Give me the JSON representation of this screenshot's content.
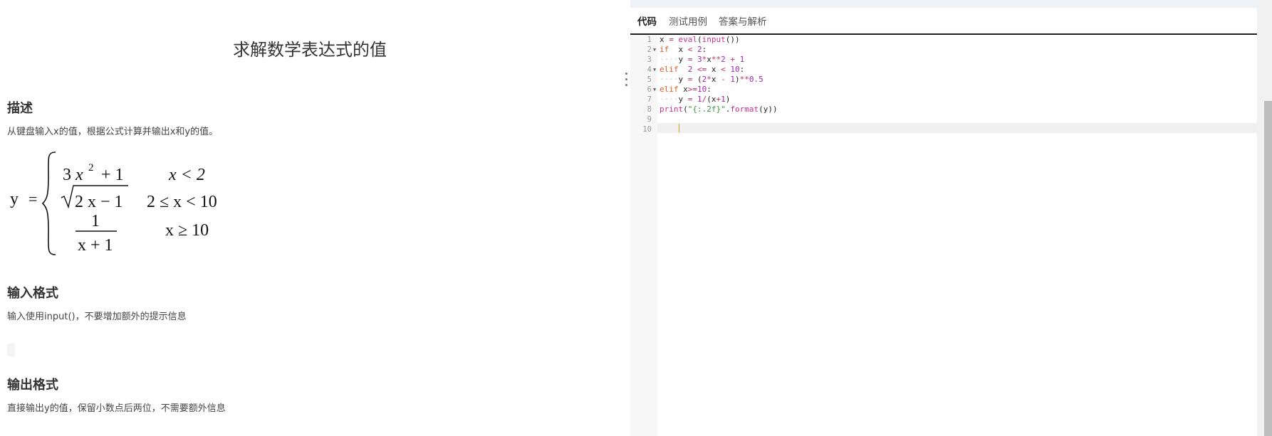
{
  "problem": {
    "title": "求解数学表达式的值",
    "sections": {
      "description_heading": "描述",
      "description_text": "从键盘输入x的值，根据公式计算并输出x和y的值。",
      "input_heading": "输入格式",
      "input_text": "输入使用input()，不要增加额外的提示信息",
      "output_heading": "输出格式",
      "output_text": "直接输出y的值，保留小数点后两位，不需要额外信息"
    },
    "formula": {
      "lhs": "y",
      "eq": "=",
      "case1_expr_a": "3",
      "case1_expr_b": "x",
      "case1_exp": "2",
      "case1_expr_c": "+ 1",
      "case1_cond": "x < 2",
      "case2_expr": "2 x − 1",
      "case2_cond": "2 ≤ x < 10",
      "case3_num": "1",
      "case3_den": "x + 1",
      "case3_cond": "x ≥ 10"
    }
  },
  "editor": {
    "tabs": [
      "代码",
      "测试用例",
      "答案与解析"
    ],
    "active_tab": "代码",
    "line_numbers": [
      "1",
      "2",
      "3",
      "4",
      "5",
      "6",
      "7",
      "8",
      "9",
      "10"
    ],
    "code_lines": [
      "x = eval(input())",
      "if  x < 2:",
      "    y = 3*x**2 + 1",
      "elif  2 <= x < 10:",
      "    y = (2*x - 1)**0.5",
      "elif x>=10:",
      "    y = 1/(x+1)",
      "print(\"{:.2f}\".format(y))",
      "",
      ""
    ]
  }
}
